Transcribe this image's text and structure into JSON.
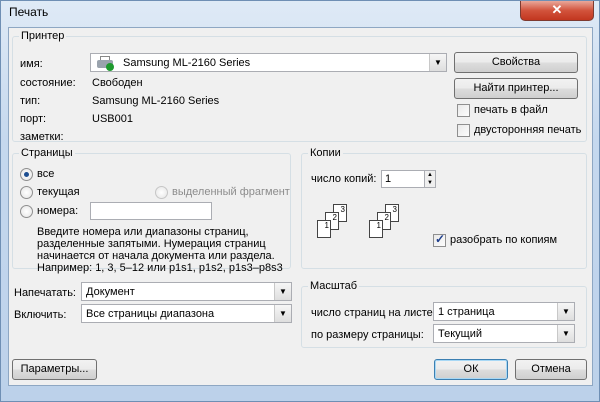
{
  "window": {
    "title": "Печать",
    "close_label": "✕"
  },
  "printer": {
    "legend": "Принтер",
    "name_label": "имя:",
    "name_value": "Samsung ML-2160 Series",
    "status_label": "состояние:",
    "status_value": "Свободен",
    "type_label": "тип:",
    "type_value": "Samsung ML-2160 Series",
    "port_label": "порт:",
    "port_value": "USB001",
    "notes_label": "заметки:",
    "properties_button": "Свойства",
    "find_button": "Найти принтер...",
    "print_to_file": "печать в файл",
    "print_to_file_checked": false,
    "duplex": "двусторонняя печать",
    "duplex_checked": false
  },
  "pages": {
    "legend": "Страницы",
    "all": "все",
    "current": "текущая",
    "selection": "выделенный фрагмент",
    "numbers": "номера:",
    "selected": "all",
    "numbers_value": "",
    "hint": [
      "Введите номера или диапазоны страниц,",
      "разделенные запятыми. Нумерация страниц",
      "начинается от начала документа или раздела.",
      "Например: 1, 3, 5–12 или p1s1, p1s2, p1s3–p8s3"
    ]
  },
  "copies": {
    "legend": "Копии",
    "count_label": "число копий:",
    "count_value": "1",
    "collate_label": "разобрать по копиям",
    "collate_checked": true,
    "page_numbers": [
      "1",
      "2",
      "3"
    ]
  },
  "print_what": {
    "label": "Напечатать:",
    "value": "Документ"
  },
  "include": {
    "label": "Включить:",
    "value": "Все страницы диапазона"
  },
  "zoom": {
    "legend": "Масштаб",
    "pages_per_sheet_label": "число страниц на листе:",
    "pages_per_sheet_value": "1 страница",
    "scale_label": "по размеру страницы:",
    "scale_value": "Текущий"
  },
  "footer": {
    "options_button": "Параметры...",
    "ok_button": "ОК",
    "cancel_button": "Отмена"
  }
}
